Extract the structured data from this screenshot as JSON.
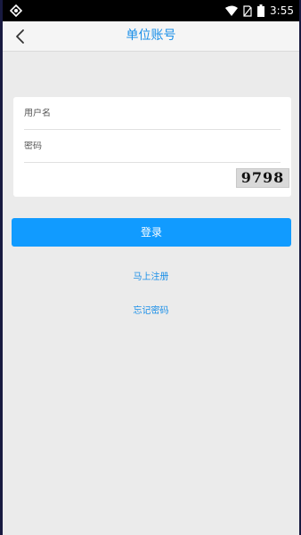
{
  "status_bar": {
    "time": "3:55",
    "icons": [
      "android-notification-icon",
      "wifi-icon",
      "no-sim-icon",
      "battery-icon"
    ]
  },
  "header": {
    "title": "单位账号",
    "back_icon": "chevron-left-icon"
  },
  "form": {
    "username_placeholder": "用户名",
    "password_placeholder": "密码",
    "captcha_placeholder": "",
    "captcha_code": "9798"
  },
  "actions": {
    "login_label": "登录",
    "register_label": "马上注册",
    "forgot_label": "忘记密码"
  },
  "colors": {
    "accent": "#1a8fe8",
    "button": "#119bff",
    "background": "#ebebeb"
  }
}
